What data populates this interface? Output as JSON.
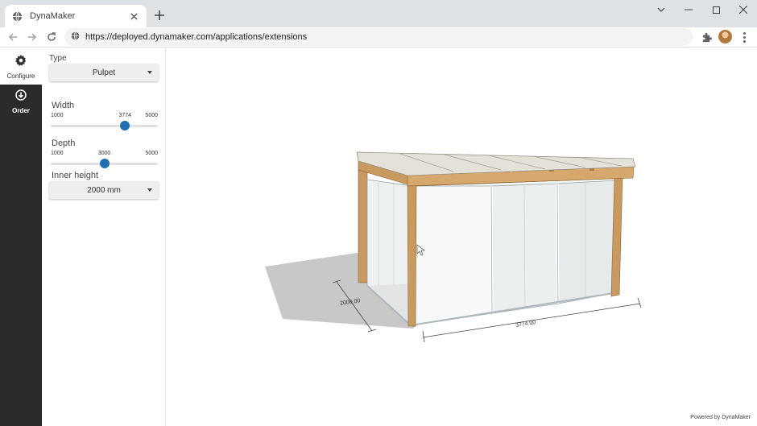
{
  "browser": {
    "tab_title": "DynaMaker",
    "url": "https://deployed.dynamaker.com/applications/extensions"
  },
  "rail": {
    "configure_label": "Configure",
    "order_label": "Order"
  },
  "panel": {
    "type": {
      "label": "Type",
      "selected": "Pulpet"
    },
    "width": {
      "label": "Width",
      "min": "1000",
      "value": "3774",
      "max": "5000",
      "fraction": 0.6935
    },
    "depth": {
      "label": "Depth",
      "min": "1000",
      "value": "3000",
      "max": "5000",
      "fraction": 0.5
    },
    "inner_height": {
      "label": "Inner height",
      "selected": "2000 mm"
    }
  },
  "viewport": {
    "dim_width": "3774.00",
    "dim_depth": "2000.00",
    "powered_by": "Powered by DynaMaker"
  },
  "colors": {
    "slider_thumb": "#1f6fb2",
    "rail_background": "#2b2b2b",
    "wood": "#c99a5f"
  }
}
